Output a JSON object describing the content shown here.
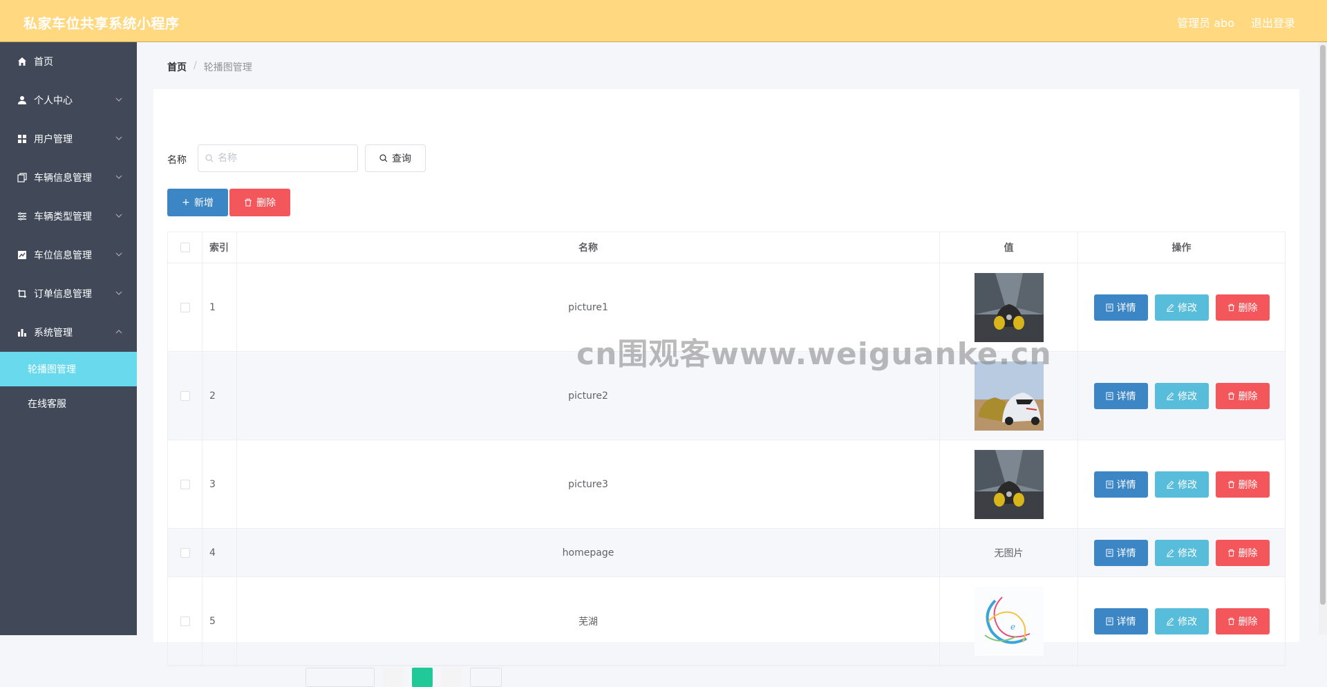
{
  "app": {
    "title": "私家车位共享系统小程序"
  },
  "header": {
    "user_label": "管理员 abo",
    "logout_label": "退出登录"
  },
  "sidebar": {
    "items": [
      {
        "label": "首页",
        "icon": "home-icon",
        "expandable": false
      },
      {
        "label": "个人中心",
        "icon": "user-icon",
        "expandable": true
      },
      {
        "label": "用户管理",
        "icon": "grid-icon",
        "expandable": true
      },
      {
        "label": "车辆信息管理",
        "icon": "copy-icon",
        "expandable": true
      },
      {
        "label": "车辆类型管理",
        "icon": "list-icon",
        "expandable": true
      },
      {
        "label": "车位信息管理",
        "icon": "chart-line-icon",
        "expandable": true
      },
      {
        "label": "订单信息管理",
        "icon": "crop-icon",
        "expandable": true
      },
      {
        "label": "系统管理",
        "icon": "bar-chart-icon",
        "expandable": true,
        "expanded": true
      }
    ],
    "sub_items": [
      {
        "label": "轮播图管理",
        "active": true
      },
      {
        "label": "在线客服",
        "active": false
      }
    ]
  },
  "breadcrumb": {
    "home": "首页",
    "separator": "/",
    "current": "轮播图管理"
  },
  "search": {
    "label": "名称",
    "placeholder": "名称",
    "value": "",
    "query_label": "查询"
  },
  "actions": {
    "add_label": "新增",
    "delete_label": "删除"
  },
  "table": {
    "headers": {
      "index": "索引",
      "name": "名称",
      "value": "值",
      "ops": "操作"
    },
    "rows": [
      {
        "index": "1",
        "name": "picture1",
        "image": "car-yellow",
        "value_text": ""
      },
      {
        "index": "2",
        "name": "picture2",
        "image": "car-race",
        "value_text": ""
      },
      {
        "index": "3",
        "name": "picture3",
        "image": "car-yellow",
        "value_text": ""
      },
      {
        "index": "4",
        "name": "homepage",
        "image": "",
        "value_text": "无图片"
      },
      {
        "index": "5",
        "name": "芜湖",
        "image": "swirl-logo",
        "value_text": ""
      }
    ],
    "op_labels": {
      "detail": "详情",
      "edit": "修改",
      "remove": "删除"
    }
  },
  "watermark": "cn围观客www.weiguanke.cn",
  "colors": {
    "header": "#ffd880",
    "sidebar": "#414959",
    "active": "#69d9ee",
    "primary": "#3d86c6",
    "info": "#58bddb",
    "danger": "#f4575b"
  }
}
